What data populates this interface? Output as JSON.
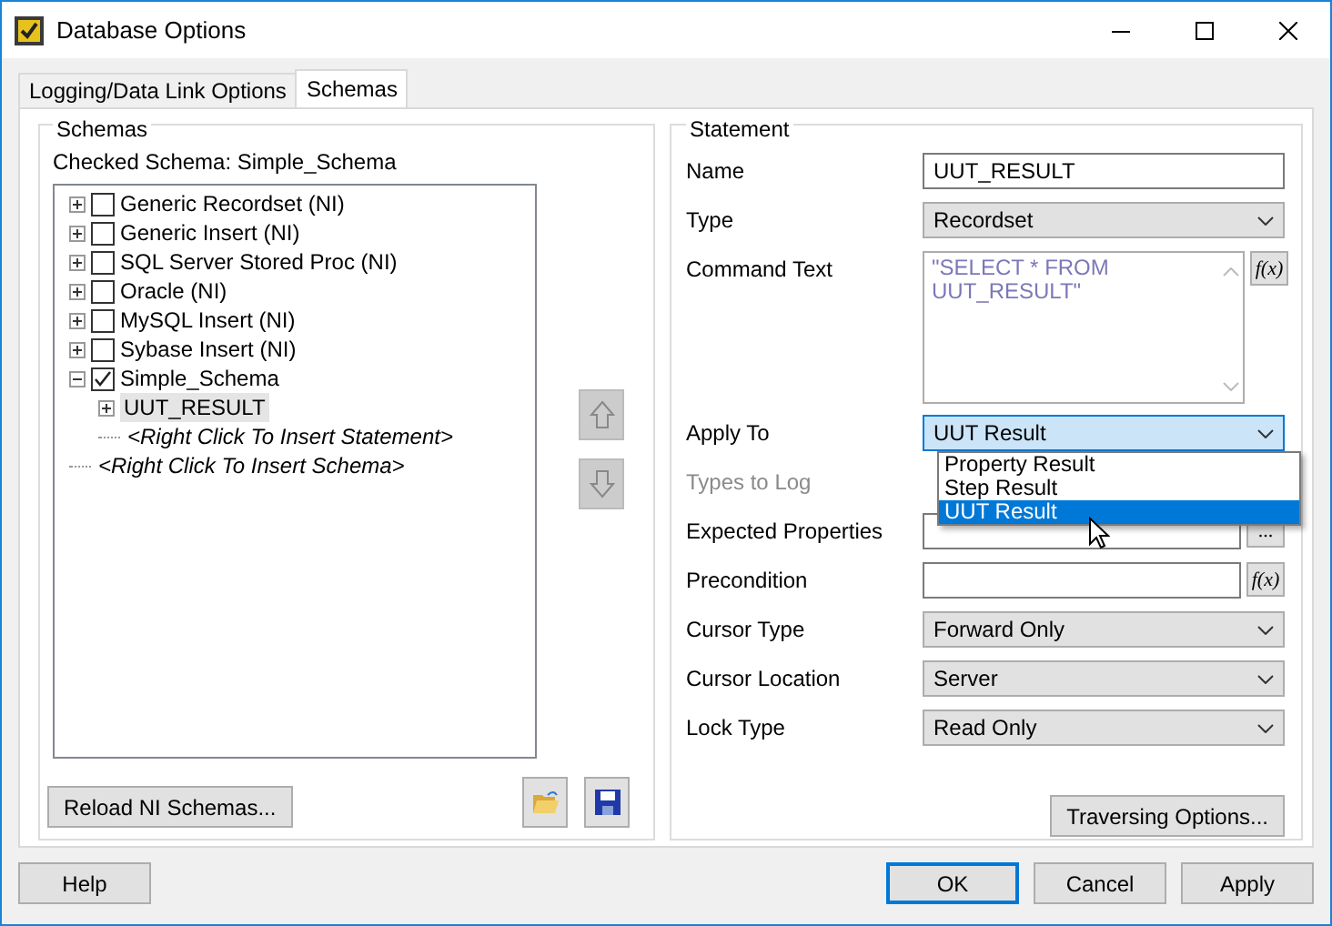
{
  "window": {
    "title": "Database Options"
  },
  "tabs": [
    {
      "label": "Logging/Data Link Options",
      "selected": false
    },
    {
      "label": "Schemas",
      "selected": true
    }
  ],
  "schemas": {
    "title": "Schemas",
    "checked_schema": "Checked Schema: Simple_Schema",
    "tree": [
      {
        "label": "Generic Recordset (NI)",
        "kind": "schema",
        "checked": false,
        "expanded": false,
        "selected": false
      },
      {
        "label": "Generic Insert (NI)",
        "kind": "schema",
        "checked": false,
        "expanded": false,
        "selected": false
      },
      {
        "label": "SQL Server Stored Proc (NI)",
        "kind": "schema",
        "checked": false,
        "expanded": false,
        "selected": false
      },
      {
        "label": "Oracle (NI)",
        "kind": "schema",
        "checked": false,
        "expanded": false,
        "selected": false
      },
      {
        "label": "MySQL Insert (NI)",
        "kind": "schema",
        "checked": false,
        "expanded": false,
        "selected": false
      },
      {
        "label": "Sybase Insert (NI)",
        "kind": "schema",
        "checked": false,
        "expanded": false,
        "selected": false
      },
      {
        "label": "Simple_Schema",
        "kind": "schema",
        "checked": true,
        "expanded": true,
        "selected": false,
        "children": [
          {
            "label": "UUT_RESULT",
            "kind": "statement",
            "expanded": false,
            "selected": true
          },
          {
            "label": "<Right Click To Insert Statement>",
            "kind": "hint",
            "selected": false
          }
        ]
      },
      {
        "label": "<Right Click To Insert Schema>",
        "kind": "hint",
        "selected": false
      }
    ],
    "reload_button": "Reload NI Schemas..."
  },
  "statement": {
    "title": "Statement",
    "fields": [
      {
        "label": "Name",
        "kind": "text",
        "value": "UUT_RESULT",
        "disabled": false
      },
      {
        "label": "Type",
        "kind": "select",
        "value": "Recordset",
        "disabled": false
      },
      {
        "label": "Command Text",
        "kind": "textarea",
        "value": "\"SELECT * FROM UUT_RESULT\"",
        "button": "f(x)",
        "disabled": false
      },
      {
        "label": "Apply To",
        "kind": "select",
        "value": "UUT Result",
        "disabled": false,
        "open": true,
        "options": [
          {
            "label": "Property Result",
            "selected": false
          },
          {
            "label": "Step Result",
            "selected": false
          },
          {
            "label": "UUT Result",
            "selected": true
          }
        ]
      },
      {
        "label": "Types to Log",
        "kind": "covered",
        "disabled": true
      },
      {
        "label": "Expected Properties",
        "kind": "text",
        "button": "...",
        "disabled": false
      },
      {
        "label": "Precondition",
        "kind": "text",
        "button": "f(x)",
        "disabled": false
      },
      {
        "label": "Cursor Type",
        "kind": "select",
        "value": "Forward Only",
        "disabled": false
      },
      {
        "label": "Cursor Location",
        "kind": "select",
        "value": "Server",
        "disabled": false
      },
      {
        "label": "Lock Type",
        "kind": "select",
        "value": "Read Only",
        "disabled": false
      }
    ],
    "traversing_button": "Traversing Options..."
  },
  "footer": [
    {
      "label": "Help",
      "default": false
    },
    {
      "label": "OK",
      "default": true
    },
    {
      "label": "Cancel",
      "default": false
    },
    {
      "label": "Apply",
      "default": false
    }
  ]
}
